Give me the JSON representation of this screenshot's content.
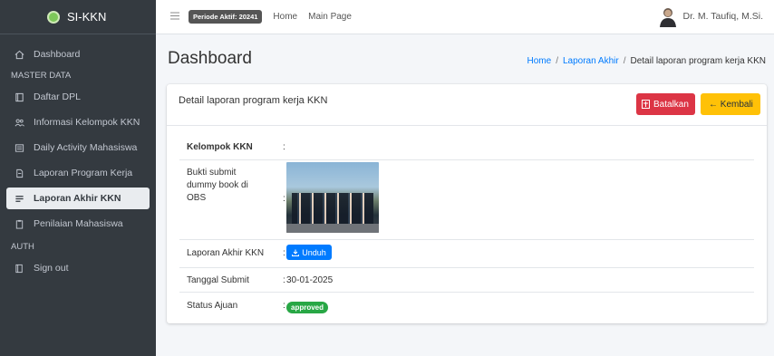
{
  "app": {
    "name": "SI-KKN"
  },
  "topbar": {
    "period_badge": "Periode Aktif: 20241",
    "links": [
      "Home",
      "Main Page"
    ],
    "user_name": "Dr. M. Taufiq, M.Si."
  },
  "sidebar": {
    "dashboard": "Dashboard",
    "section_master": "MASTER DATA",
    "items": [
      {
        "label": "Daftar DPL",
        "icon": "book-icon"
      },
      {
        "label": "Informasi Kelompok KKN",
        "icon": "users-icon"
      },
      {
        "label": "Daily Activity Mahasiswa",
        "icon": "list-icon"
      },
      {
        "label": "Laporan Program Kerja",
        "icon": "file-icon"
      },
      {
        "label": "Laporan Akhir KKN",
        "icon": "report-icon",
        "active": true
      },
      {
        "label": "Penilaian Mahasiswa",
        "icon": "clipboard-icon"
      }
    ],
    "section_auth": "AUTH",
    "signout": "Sign out"
  },
  "page": {
    "title": "Dashboard",
    "breadcrumb": [
      "Home",
      "Laporan Akhir",
      "Detail laporan program kerja KKN"
    ]
  },
  "card": {
    "title": "Detail laporan program kerja KKN",
    "cancel_label": "Batalkan",
    "back_label": "← Kembali",
    "rows": {
      "kelompok_label": "Kelompok KKN",
      "kelompok_value": "",
      "bukti_label": "Bukti submit dummy book di OBS",
      "laporan_label": "Laporan Akhir KKN",
      "download_label": "Unduh",
      "tanggal_label": "Tanggal Submit",
      "tanggal_value": "30-01-2025",
      "status_label": "Status Ajuan",
      "status_value": "approved"
    }
  },
  "colors": {
    "sidebar_bg": "#343a40",
    "danger": "#dc3545",
    "warning": "#ffc107",
    "primary": "#007bff",
    "success": "#28a745"
  }
}
